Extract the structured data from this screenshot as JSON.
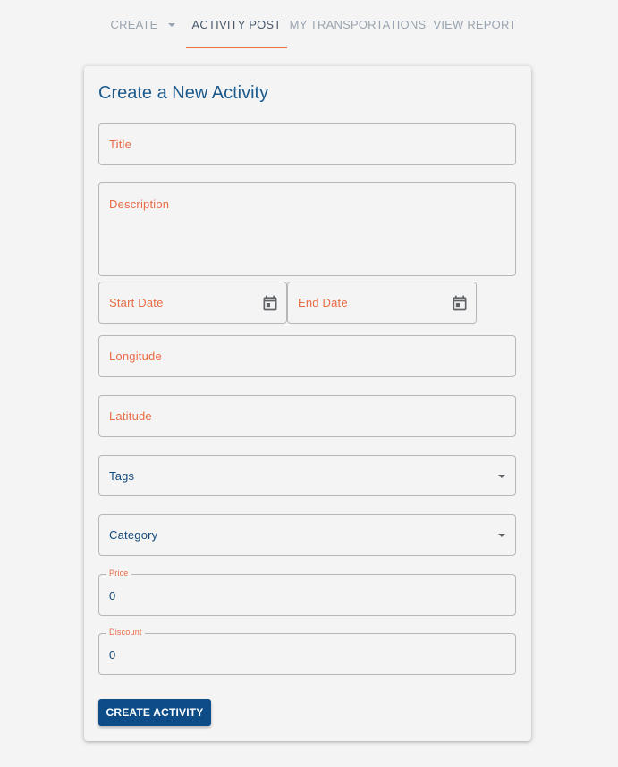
{
  "nav": {
    "tabs": [
      {
        "label": "CREATE",
        "has_dropdown": true,
        "active": false
      },
      {
        "label": "ACTIVITY POST",
        "active": true
      },
      {
        "label": "MY TRANSPORTATIONS",
        "active": false
      },
      {
        "label": "VIEW REPORT",
        "active": false
      }
    ]
  },
  "form": {
    "title": "Create a New Activity",
    "fields": {
      "title": {
        "label": "Title"
      },
      "description": {
        "label": "Description"
      },
      "start_date": {
        "label": "Start Date",
        "icon": "calendar-icon"
      },
      "end_date": {
        "label": "End Date",
        "icon": "calendar-icon"
      },
      "longitude": {
        "label": "Longitude"
      },
      "latitude": {
        "label": "Latitude"
      },
      "tags": {
        "label": "Tags",
        "icon": "chevron-down-icon"
      },
      "category": {
        "label": "Category",
        "icon": "chevron-down-icon"
      },
      "price": {
        "label": "Price",
        "value": "0"
      },
      "discount": {
        "label": "Discount",
        "value": "0"
      }
    },
    "submit_label": "CREATE ACTIVITY"
  },
  "colors": {
    "background": "#f4f4f4",
    "accent_label": "#e96b45",
    "primary_text": "#13497a",
    "title_text": "#1b5a8c",
    "button_bg": "#0d4c87",
    "tab_active_underline": "#f06a40",
    "tab_inactive": "#9aa4b0"
  }
}
